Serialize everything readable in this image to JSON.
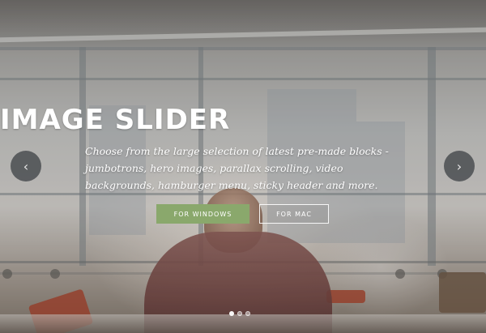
{
  "slider": {
    "title": "IMAGE SLIDER",
    "subtitle": "Choose from the large selection of latest pre-made blocks - jumbotrons, hero images, parallax scrolling, video backgrounds, hamburger menu, sticky header and more.",
    "buttons": {
      "windows_label": "FOR WINDOWS",
      "mac_label": "FOR MAC"
    },
    "prev_icon": "chevron-left-icon",
    "next_icon": "chevron-right-icon",
    "prev_glyph": "‹",
    "next_glyph": "›",
    "indicators": [
      {
        "active": true
      },
      {
        "active": false
      },
      {
        "active": false
      }
    ],
    "colors": {
      "primary_button": "#8aa86c",
      "text": "#ffffff",
      "arrow_bg": "#3c4044"
    }
  }
}
